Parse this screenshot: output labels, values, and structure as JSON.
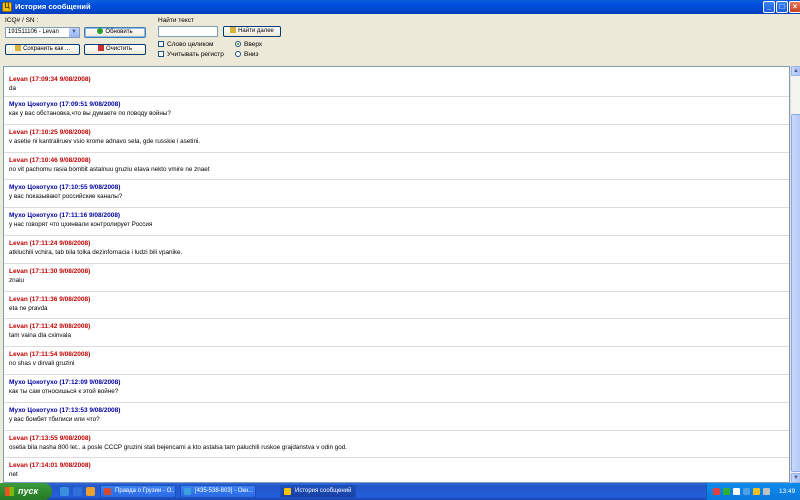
{
  "window": {
    "title": "История сообщений"
  },
  "toolbar": {
    "icq_label": "ICQ# / SN :",
    "icq_selected": "191511106 - Levan",
    "refresh_label": "Обновить",
    "save_label": "Сохранить как ...",
    "clear_label": "Очистить",
    "search_label": "Найти текст",
    "search_value": "",
    "find_next_label": "Найти далее",
    "whole_word_label": "Слово целиком",
    "match_case_label": "Учитывать регистр",
    "up_label": "Вверх",
    "down_label": "Вниз",
    "direction_selected": "up"
  },
  "colors": {
    "levan": "#c00000",
    "other": "#0000a0"
  },
  "messages": [
    {
      "author": "Levan",
      "time": "17:09:34 9/08/2008",
      "text": "da",
      "color": "red"
    },
    {
      "author": "Мухо Цокотухо",
      "time": "17:09:51 9/08/2008",
      "text": "как у вас обстановка,что вы думаете по поводу войны?",
      "color": "blue"
    },
    {
      "author": "Levan",
      "time": "17:10:25 9/08/2008",
      "text": "v asetie ni kantraliruev vsio krome adnavo sela, gde russkie i asetini.",
      "color": "red"
    },
    {
      "author": "Levan",
      "time": "17:10:46 9/08/2008",
      "text": "no vit pachomu rasia bombit astalnuu gruziu etava nekto vmire ne znaet",
      "color": "red"
    },
    {
      "author": "Мухо Цокотухо",
      "time": "17:10:55 9/08/2008",
      "text": "у вас показывают российские каналы?",
      "color": "blue"
    },
    {
      "author": "Мухо Цокотухо",
      "time": "17:11:16 9/08/2008",
      "text": "у нас говорят что цхинвали контролирует Россия",
      "color": "blue"
    },
    {
      "author": "Levan",
      "time": "17:11:24 9/08/2008",
      "text": "atkluchili vchira, tab bila tolka dezinfornacia i ludzi bili vpanike.",
      "color": "red"
    },
    {
      "author": "Levan",
      "time": "17:11:30 9/08/2008",
      "text": "znaiu",
      "color": "red"
    },
    {
      "author": "Levan",
      "time": "17:11:36 9/08/2008",
      "text": "eta ne pravda",
      "color": "red"
    },
    {
      "author": "Levan",
      "time": "17:11:42 9/08/2008",
      "text": "tam vaina dla cxinvala",
      "color": "red"
    },
    {
      "author": "Levan",
      "time": "17:11:54 9/08/2008",
      "text": "no shas v dirvali gruzini",
      "color": "red"
    },
    {
      "author": "Мухо Цокотухо",
      "time": "17:12:09 9/08/2008",
      "text": "как ты сам относишься к этой войне?",
      "color": "blue"
    },
    {
      "author": "Мухо Цокотухо",
      "time": "17:13:53 9/08/2008",
      "text": "у вас бомбят тбилиси или что?",
      "color": "blue"
    },
    {
      "author": "Levan",
      "time": "17:13:55 9/08/2008",
      "text": "osetia bila nasha 800 let.. a posle CCCP gruzini stali bejencami a kto astalsa tam paluchili ruskoe grajdanstva v odin god.",
      "color": "red"
    },
    {
      "author": "Levan",
      "time": "17:14:01 9/08/2008",
      "text": "net",
      "color": "red"
    }
  ],
  "taskbar": {
    "start_label": "пуск",
    "tasks": [
      {
        "label": "Правда о Грузии - О...",
        "icon_color": "#d94a2a",
        "active": false
      },
      {
        "label": "[435-538-803] - Окн...",
        "icon_color": "#3aa0e0",
        "active": false
      },
      {
        "label": "История сообщений",
        "icon_color": "#f5c400",
        "active": true
      }
    ],
    "clock": "13:49"
  }
}
